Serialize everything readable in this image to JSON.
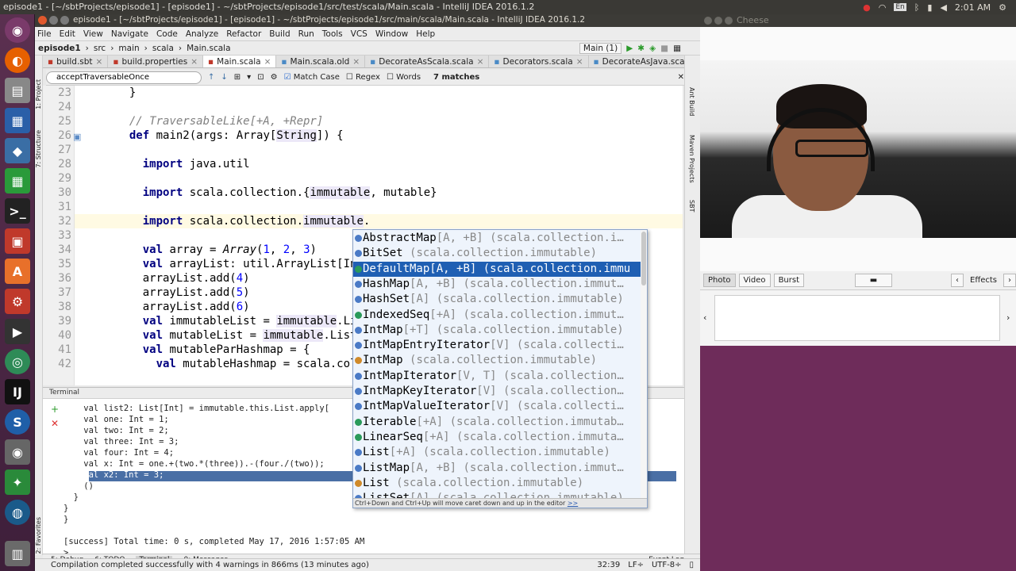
{
  "topbar": {
    "title": "episode1 - [~/sbtProjects/episode1] - [episode1] - ~/sbtProjects/episode1/src/test/scala/Main.scala - IntelliJ IDEA 2016.1.2",
    "kb": "En",
    "time": "2:01 AM"
  },
  "ide": {
    "title": "episode1 - [~/sbtProjects/episode1] - [episode1] - ~/sbtProjects/episode1/src/main/scala/Main.scala - IntelliJ IDEA 2016.1.2",
    "menu": [
      "File",
      "Edit",
      "View",
      "Navigate",
      "Code",
      "Analyze",
      "Refactor",
      "Build",
      "Run",
      "Tools",
      "VCS",
      "Window",
      "Help"
    ],
    "nav": [
      "episode1",
      "src",
      "main",
      "scala",
      "Main.scala"
    ],
    "run_config": "Main (1)",
    "tabs": [
      "build.sbt",
      "build.properties",
      "Main.scala",
      "Main.scala.old",
      "DecorateAsScala.scala",
      "Decorators.scala",
      "DecorateAsJava.scala"
    ],
    "find": {
      "value": "acceptTraversableOnce",
      "match_case": "Match Case",
      "regex": "Regex",
      "words": "Words",
      "matches": "7 matches"
    },
    "right_strip": [
      "Ant Build",
      "Maven Projects",
      "SBT"
    ],
    "left_strip": [
      "1: Project",
      "7: Structure",
      "2: Favorites"
    ]
  },
  "code": {
    "lines": [
      {
        "n": "23",
        "t": "  }"
      },
      {
        "n": "24",
        "t": ""
      },
      {
        "n": "25",
        "t": "  // TraversableLike[+A, +Repr]"
      },
      {
        "n": "26",
        "t": "  def main2(args: Array[String]) {"
      },
      {
        "n": "27",
        "t": ""
      },
      {
        "n": "28",
        "t": "    import java.util"
      },
      {
        "n": "29",
        "t": ""
      },
      {
        "n": "30",
        "t": "    import scala.collection.{immutable, mutable}"
      },
      {
        "n": "31",
        "t": ""
      },
      {
        "n": "32",
        "t": "    import scala.collection.immutable."
      },
      {
        "n": "33",
        "t": ""
      },
      {
        "n": "34",
        "t": "    val array = Array(1, 2, 3)"
      },
      {
        "n": "35",
        "t": "    val arrayList: util.ArrayList[Int"
      },
      {
        "n": "36",
        "t": "    arrayList.add(4)"
      },
      {
        "n": "37",
        "t": "    arrayList.add(5)"
      },
      {
        "n": "38",
        "t": "    arrayList.add(6)"
      },
      {
        "n": "39",
        "t": "    val immutableList = immutable.Lis"
      },
      {
        "n": "40",
        "t": "    val mutableList = immutable.List"
      },
      {
        "n": "41",
        "t": "    val mutableParHashmap = {"
      },
      {
        "n": "42",
        "t": "      val mutableHashmap = scala.col"
      }
    ]
  },
  "completion": {
    "items": [
      {
        "name": "AbstractMap",
        "gen": "[A, +B]",
        "pkg": "(scala.collection.i…"
      },
      {
        "name": "BitSet",
        "gen": "",
        "pkg": "(scala.collection.immutable)"
      },
      {
        "name": "DefaultMap",
        "gen": "[A, +B]",
        "pkg": "(scala.collection.immu"
      },
      {
        "name": "HashMap",
        "gen": "[A, +B]",
        "pkg": "(scala.collection.immut…"
      },
      {
        "name": "HashSet",
        "gen": "[A]",
        "pkg": "(scala.collection.immutable)"
      },
      {
        "name": "IndexedSeq",
        "gen": "[+A]",
        "pkg": "(scala.collection.immut…"
      },
      {
        "name": "IntMap",
        "gen": "[+T]",
        "pkg": "(scala.collection.immutable)"
      },
      {
        "name": "IntMapEntryIterator",
        "gen": "[V]",
        "pkg": "(scala.collecti…"
      },
      {
        "name": "IntMap",
        "gen": "",
        "pkg": "(scala.collection.immutable)"
      },
      {
        "name": "IntMapIterator",
        "gen": "[V, T]",
        "pkg": "(scala.collection…"
      },
      {
        "name": "IntMapKeyIterator",
        "gen": "[V]",
        "pkg": "(scala.collection…"
      },
      {
        "name": "IntMapValueIterator",
        "gen": "[V]",
        "pkg": "(scala.collecti…"
      },
      {
        "name": "Iterable",
        "gen": "[+A]",
        "pkg": "(scala.collection.immutab…"
      },
      {
        "name": "LinearSeq",
        "gen": "[+A]",
        "pkg": "(scala.collection.immuta…"
      },
      {
        "name": "List",
        "gen": "[+A]",
        "pkg": "(scala.collection.immutable)"
      },
      {
        "name": "ListMap",
        "gen": "[A, +B]",
        "pkg": "(scala.collection.immut…"
      },
      {
        "name": "List",
        "gen": "",
        "pkg": "(scala.collection.immutable)"
      },
      {
        "name": "ListSet",
        "gen": "[A]",
        "pkg": "(scala.collection.immutable)"
      }
    ],
    "footer": "Ctrl+Down and Ctrl+Up will move caret down and up in the editor",
    "footer_link": ">>"
  },
  "terminal": {
    "header": "Terminal",
    "lines": [
      "    val list2: List[Int] = immutable.this.List.apply[",
      "    val one: Int = 1;",
      "    val two: Int = 2;",
      "    val three: Int = 3;",
      "    val four: Int = 4;",
      "    val x: Int = one.+(two.*(three)).-(four./(two));",
      "    val x2: Int = 3;",
      "    ()",
      "  }",
      "}",
      "}",
      "",
      "[success] Total time: 0 s, completed May 17, 2016 1:57:05 AM",
      ">"
    ]
  },
  "bottom_tabs": [
    "5: Debug",
    "6: TODO",
    "Terminal",
    "0: Messages",
    "Event Log"
  ],
  "status": {
    "msg": "Compilation completed successfully with 4 warnings in 866ms (13 minutes ago)",
    "pos": "32:39",
    "lf": "LF÷",
    "enc": "UTF-8÷"
  },
  "cheese": {
    "title": "Cheese",
    "modes": [
      "Photo",
      "Video",
      "Burst"
    ],
    "effects": "Effects"
  }
}
